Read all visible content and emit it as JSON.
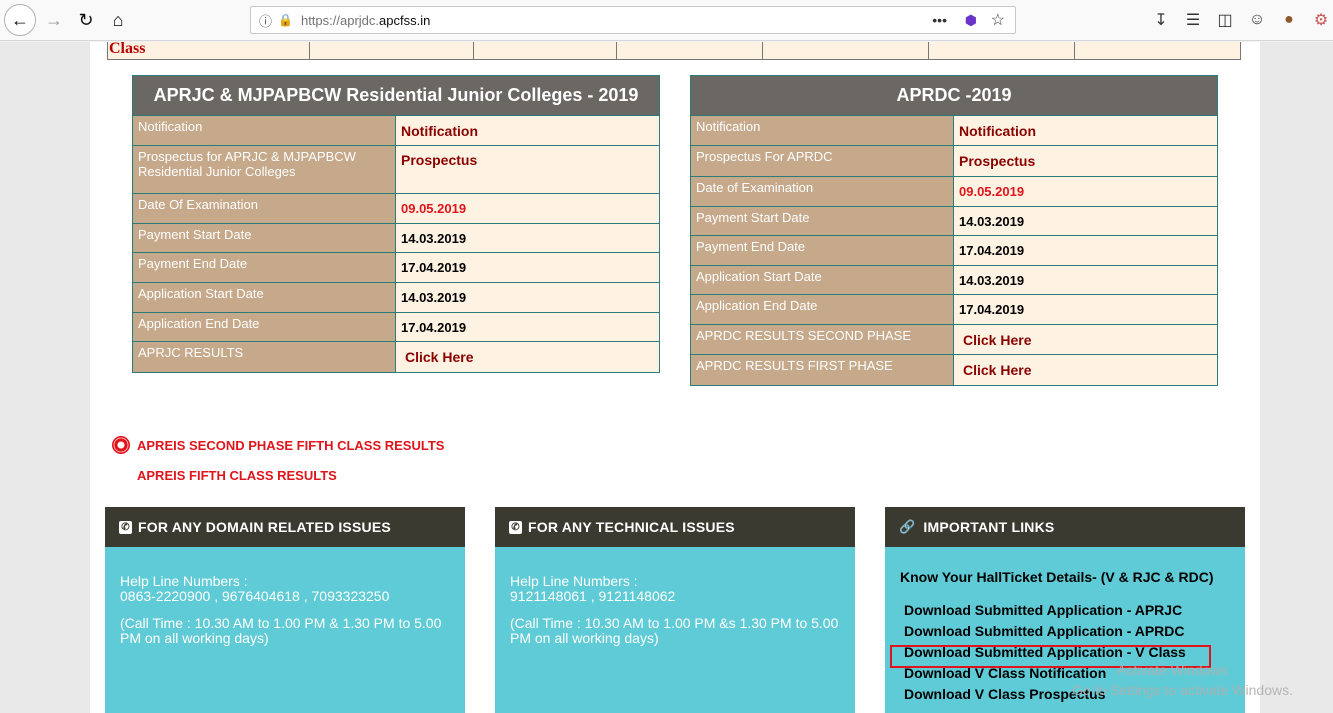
{
  "browser": {
    "url_prefix": "https://aprjdc.",
    "url_domain": "apcfss.in"
  },
  "top_row": {
    "class_label": "Class"
  },
  "table_left": {
    "title": "APRJC & MJPAPBCW Residential Junior Colleges - 2019",
    "rows": [
      {
        "label": "Notification",
        "value": "Notification"
      },
      {
        "label": "Prospectus for APRJC & MJPAPBCW Residential Junior Colleges",
        "value": "Prospectus"
      },
      {
        "label": "Date Of Examination",
        "value": "09.05.2019"
      },
      {
        "label": "Payment Start Date",
        "value": "14.03.2019"
      },
      {
        "label": "Payment End Date",
        "value": "17.04.2019"
      },
      {
        "label": "Application Start Date",
        "value": "14.03.2019"
      },
      {
        "label": "Application End Date",
        "value": "17.04.2019"
      },
      {
        "label": "APRJC RESULTS",
        "value": "Click Here"
      }
    ]
  },
  "table_right": {
    "title": "APRDC -2019",
    "rows": [
      {
        "label": "Notification",
        "value": "Notification"
      },
      {
        "label": "Prospectus For APRDC",
        "value": "Prospectus"
      },
      {
        "label": "Date of Examination",
        "value": "09.05.2019"
      },
      {
        "label": "Payment Start Date",
        "value": "14.03.2019"
      },
      {
        "label": "Payment End Date",
        "value": "17.04.2019"
      },
      {
        "label": "Application Start Date",
        "value": "14.03.2019"
      },
      {
        "label": "Application End Date",
        "value": "17.04.2019"
      },
      {
        "label": "APRDC RESULTS SECOND PHASE",
        "value": "Click Here"
      },
      {
        "label": "APRDC RESULTS FIRST PHASE",
        "value": "Click Here"
      }
    ]
  },
  "alerts": [
    "APREIS SECOND PHASE FIFTH CLASS RESULTS",
    "APREIS FIFTH CLASS RESULTS"
  ],
  "boxes": {
    "domain": {
      "title": "FOR ANY DOMAIN RELATED ISSUES",
      "helpline_label": "Help Line Numbers :",
      "numbers": "0863-2220900 , 9676404618 , 7093323250",
      "call_time": "(Call Time : 10.30 AM to 1.00 PM & 1.30 PM to 5.00 PM on all working days)"
    },
    "technical": {
      "title": "FOR ANY TECHNICAL ISSUES",
      "helpline_label": "Help Line Numbers :",
      "numbers": "9121148061 , 9121148062",
      "call_time": "(Call Time : 10.30 AM to 1.00 PM &s 1.30 PM to 5.00 PM on all working days)"
    },
    "links": {
      "title": "IMPORTANT LINKS",
      "know": "Know Your HallTicket Details- (V & RJC & RDC)",
      "items": [
        "Download Submitted Application - APRJC",
        "Download Submitted Application - APRDC",
        "Download Submitted Application - V Class",
        "Download V Class Notification",
        "Download V Class Prospectus"
      ]
    }
  },
  "watermark": {
    "line1": "Activate Windows",
    "line2": "Go to Settings to activate Windows."
  }
}
